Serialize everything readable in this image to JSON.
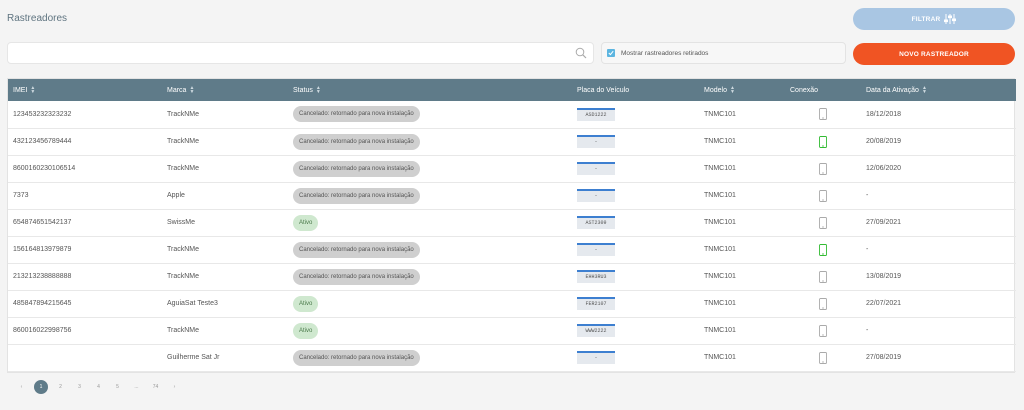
{
  "page": {
    "title": "Rastreadores"
  },
  "toolbar": {
    "filter_label": "FILTRAR",
    "new_label": "NOVO RASTREADOR",
    "search_placeholder": "",
    "search_value": "",
    "show_retired_label": "Mostrar rastreadores retirados",
    "show_retired_checked": true
  },
  "colors": {
    "header_bg": "#5f7b89",
    "accent_orange": "#f05423",
    "filter_blue": "#a9c6e3",
    "connected_green": "#33bb33",
    "disconnected_gray": "#aaaaaa"
  },
  "table": {
    "columns": [
      "IMEI",
      "Marca",
      "Status",
      "Placa do Veículo",
      "Modelo",
      "Conexão",
      "Data da Ativação"
    ],
    "rows": [
      {
        "imei": "123453232323232",
        "marca": "TrackNMe",
        "status": "Cancelado: retornado para nova instalação",
        "status_type": "cancel",
        "placa": "ASD1222",
        "modelo": "TNMC101",
        "conexao": "disconnected",
        "data": "18/12/2018"
      },
      {
        "imei": "432123456789444",
        "marca": "TrackNMe",
        "status": "Cancelado: retornado para nova instalação",
        "status_type": "cancel",
        "placa": "-",
        "modelo": "TNMC101",
        "conexao": "connected",
        "data": "20/08/2019"
      },
      {
        "imei": "8600160230106514",
        "marca": "TrackNMe",
        "status": "Cancelado: retornado para nova instalação",
        "status_type": "cancel",
        "placa": "-",
        "modelo": "TNMC101",
        "conexao": "disconnected",
        "data": "12/06/2020"
      },
      {
        "imei": "7373",
        "marca": "Apple",
        "status": "Cancelado: retornado para nova instalação",
        "status_type": "cancel",
        "placa": "-",
        "modelo": "TNMC101",
        "conexao": "disconnected",
        "data": "-"
      },
      {
        "imei": "654874651542137",
        "marca": "SwissMe",
        "status": "Ativo",
        "status_type": "ativo",
        "placa": "AST2309",
        "modelo": "TNMC101",
        "conexao": "disconnected",
        "data": "27/09/2021"
      },
      {
        "imei": "156164813979879",
        "marca": "TrackNMe",
        "status": "Cancelado: retornado para nova instalação",
        "status_type": "cancel",
        "placa": "-",
        "modelo": "TNMC101",
        "conexao": "connected",
        "data": "-"
      },
      {
        "imei": "213213238888888",
        "marca": "TrackNMe",
        "status": "Cancelado: retornado para nova instalação",
        "status_type": "cancel",
        "placa": "EHH3RU3",
        "modelo": "TNMC101",
        "conexao": "disconnected",
        "data": "13/08/2019"
      },
      {
        "imei": "485847894215645",
        "marca": "AguiaSat Teste3",
        "status": "Ativo",
        "status_type": "ativo",
        "placa": "FER2107",
        "modelo": "TNMC101",
        "conexao": "disconnected",
        "data": "22/07/2021"
      },
      {
        "imei": "860016022998756",
        "marca": "TrackNMe",
        "status": "Ativo",
        "status_type": "ativo",
        "placa": "WWW2222",
        "modelo": "TNMC101",
        "conexao": "disconnected",
        "data": "-"
      },
      {
        "imei": "",
        "marca": "Guilherme Sat Jr",
        "status": "Cancelado: retornado para nova instalação",
        "status_type": "cancel",
        "placa": "-",
        "modelo": "TNMC101",
        "conexao": "disconnected",
        "data": "27/08/2019"
      }
    ]
  },
  "pagination": {
    "prev": "‹",
    "pages": [
      "1",
      "2",
      "3",
      "4",
      "5",
      "...",
      "74"
    ],
    "current": "1",
    "next": "›"
  }
}
